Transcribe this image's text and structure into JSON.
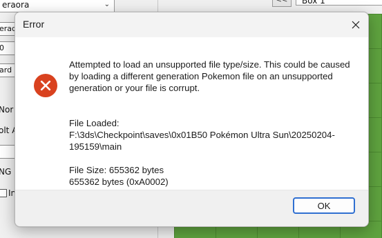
{
  "background_app": {
    "species_select": "eraora",
    "field_labels": [
      "erado",
      "0",
      "ard",
      "Nor",
      "olt A",
      "",
      "NG",
      "In"
    ],
    "box_select": "Box 1",
    "box_nav_label": "<<"
  },
  "dialog": {
    "title": "Error",
    "message": "Attempted to load an unsupported file type/size. This could be caused by loading a different generation Pokemon file on an unsupported generation or your file is corrupt.",
    "file_loaded_label": "File Loaded:",
    "file_loaded_path": "F:\\3ds\\Checkpoint\\saves\\0x01B50 Pokémon Ultra Sun\\20250204-195159\\main",
    "file_size_label": "File Size: 655362 bytes",
    "file_size_hex": "655362 bytes (0xA0002)",
    "ok_label": "OK"
  },
  "colors": {
    "error_icon": "#d9421f",
    "ok_border": "#2f6fd1",
    "grid_green": "#5fa33f"
  },
  "icons": {
    "error": "error-x-circle-icon",
    "close": "close-icon",
    "dropdown": "chevron-down-icon"
  }
}
